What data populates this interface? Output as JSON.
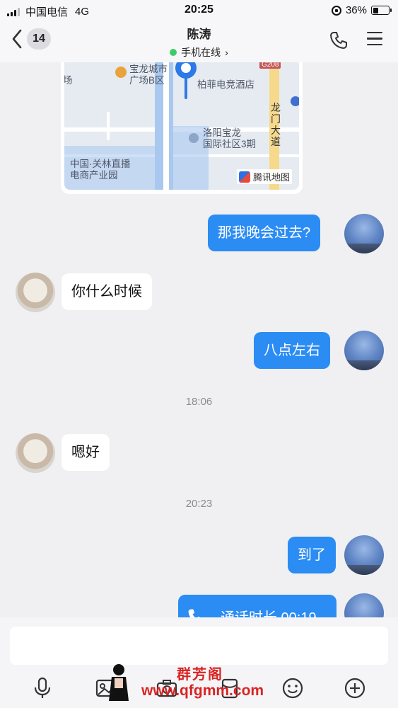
{
  "status_bar": {
    "carrier": "中国电信",
    "network": "4G",
    "time": "20:25",
    "battery_percent": "36%",
    "battery_level": 0.36
  },
  "header": {
    "back_badge": "14",
    "contact_name": "陈涛",
    "online_status": "手机在线",
    "online_chevron": "›",
    "icons": [
      "back-chevron-icon",
      "phone-icon",
      "menu-icon"
    ]
  },
  "map": {
    "labels": {
      "poi1": "宝龙城市\n广场B区",
      "hotel": "柏菲电竞酒店",
      "road_tag": "G208",
      "road_name": "龙\n门\n大\n道",
      "community": "洛阳宝龙\n国际社区3期",
      "park": "中国·关林直播\n电商产业园",
      "left_edge": "场",
      "provider": "腾讯地图"
    }
  },
  "messages": {
    "m1": "那我晚会过去?",
    "m2": "你什么时候",
    "m3": "八点左右",
    "t1": "18:06",
    "m4": "嗯好",
    "t2": "20:23",
    "m5": "到了",
    "call": "通话时长 00:19"
  },
  "watermark": {
    "title": "群芳阁",
    "url": "www.qfgmm.com"
  },
  "colors": {
    "accent_blue": "#2b8cf3",
    "online_green": "#3ccd6a",
    "watermark_red": "#d92323"
  },
  "toolbar": [
    "microphone-icon",
    "photo-icon",
    "camera-icon",
    "red-packet-icon",
    "emoji-icon",
    "plus-icon"
  ]
}
